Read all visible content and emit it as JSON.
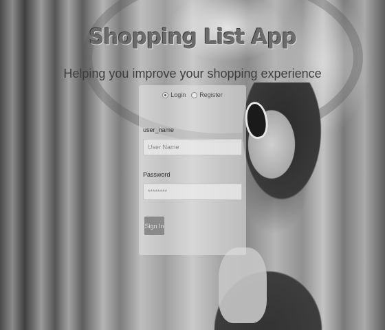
{
  "app": {
    "title": "Shopping List App",
    "subtitle": "Helping you improve your shopping experience"
  },
  "auth_mode": {
    "options": [
      {
        "label": "Login",
        "selected": true
      },
      {
        "label": "Register",
        "selected": false
      }
    ]
  },
  "form": {
    "username": {
      "label": "user_name",
      "placeholder": "User Name",
      "value": ""
    },
    "password": {
      "label": "Password",
      "placeholder": "********",
      "value": ""
    },
    "submit_label": "Sign In"
  },
  "colors": {
    "panel": "#e1e1e1",
    "button": "#8a8a8a",
    "title": "#6b6b6b"
  }
}
